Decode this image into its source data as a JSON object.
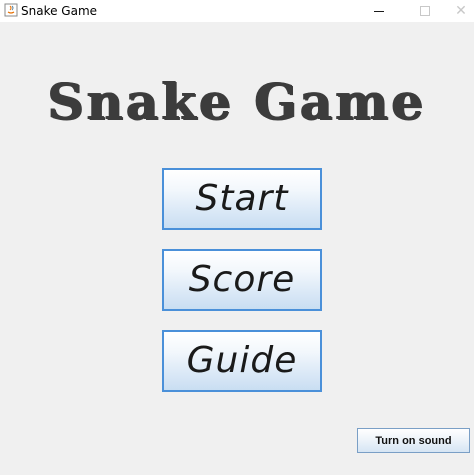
{
  "window": {
    "title": "Snake Game",
    "icon": "java-app-icon",
    "controls": {
      "minimize_icon": "minimize-icon",
      "maximize_icon": "maximize-icon",
      "close_icon": "close-icon",
      "close_glyph": "✕"
    }
  },
  "main": {
    "title": "Snake Game",
    "menu": [
      {
        "label": "Start"
      },
      {
        "label": "Score"
      },
      {
        "label": "Guide"
      }
    ],
    "sound_button_label": "Turn on sound"
  },
  "colors": {
    "background": "#f0f0f0",
    "title_text": "#3c3c3c",
    "button_border": "#4a90d9",
    "button_gradient_bottom": "#c9def2"
  }
}
